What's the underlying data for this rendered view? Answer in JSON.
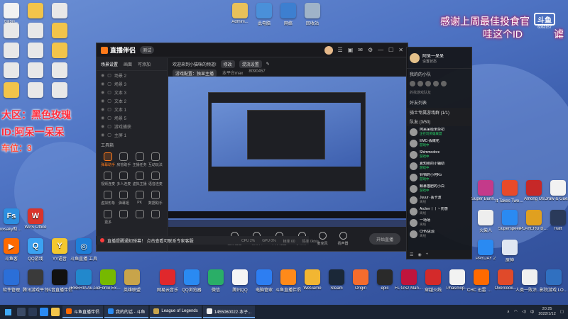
{
  "overlay": {
    "line1": "大区：黑色玫瑰",
    "line2": "ID:阿呆一呆呆",
    "line3": "车位：3",
    "top_right_line1": "感谢上周最佳投食官",
    "top_right_line2": "哇这个ID",
    "top_right_line3": "谑",
    "watermark_num": "6062157"
  },
  "desktop_top_icons": [
    {
      "label": "Admini...",
      "color": "#e8c15a"
    },
    {
      "label": "此电脑",
      "color": "#4a90d9"
    },
    {
      "label": "网络",
      "color": "#3d7fd0"
    },
    {
      "label": "回收站",
      "color": "#9fb3c8"
    }
  ],
  "desktop_left_icons": [
    {
      "label": "bilibili...",
      "color": "#f2f2f2"
    },
    {
      "label": "",
      "color": "#f2c44a"
    },
    {
      "label": "",
      "color": "#e8e8e8"
    },
    {
      "label": "",
      "color": "#e8e8e8"
    },
    {
      "label": "",
      "color": "#e8e8e8"
    },
    {
      "label": "",
      "color": "#f2c44a"
    },
    {
      "label": "",
      "color": "#e8e8e8"
    },
    {
      "label": "",
      "color": "#e8e8e8"
    },
    {
      "label": "",
      "color": "#f2c44a"
    },
    {
      "label": "",
      "color": "#e8e8e8"
    },
    {
      "label": "",
      "color": "#e8e8e8"
    },
    {
      "label": "",
      "color": "#e8e8e8"
    },
    {
      "label": "",
      "color": "#f2c44a"
    },
    {
      "label": "",
      "color": "#e8e8e8"
    },
    {
      "label": "",
      "color": "#e8e8e8"
    }
  ],
  "desktop_row1": [
    {
      "label": "Foxsaky助手 漫画",
      "color": "#2d8fe0",
      "glyph": "Fs"
    },
    {
      "label": "WPS Office",
      "color": "#d9342b",
      "glyph": "W"
    }
  ],
  "desktop_row2": [
    {
      "label": "斗鱼客",
      "color": "#ff6a00",
      "glyph": "▶"
    },
    {
      "label": "QQ游戏",
      "color": "#3ba2f2",
      "glyph": "Q"
    },
    {
      "label": "YY语音",
      "color": "#f4c82e",
      "glyph": "Y"
    },
    {
      "label": "斗鱼直播 工具",
      "color": "#1e7fd8",
      "glyph": "◎"
    }
  ],
  "desktop_bottom_row": [
    {
      "label": "软件管理",
      "color": "#2b6fd8"
    },
    {
      "label": "腾讯游戏平台",
      "color": "#3a3a3a"
    },
    {
      "label": "抖音直播伴侣",
      "color": "#111111"
    },
    {
      "label": "IRBERIA Audio...",
      "color": "#2288cc"
    },
    {
      "label": "GeForce Experience",
      "color": "#76b900"
    },
    {
      "label": "英雄联盟",
      "color": "#c8a44a"
    },
    {
      "label": "网易云音乐",
      "color": "#e0282c"
    },
    {
      "label": "QQ浏览器",
      "color": "#2a8af2"
    },
    {
      "label": "微信",
      "color": "#2aae67"
    },
    {
      "label": "腾讯QQ",
      "color": "#f5f5f5"
    },
    {
      "label": "电脑管家",
      "color": "#2d7ef2"
    },
    {
      "label": "斗鱼直播伴侣",
      "color": "#ff8a1a"
    },
    {
      "label": "WeGame",
      "color": "#f2b632"
    },
    {
      "label": "Steam",
      "color": "#1b2838"
    },
    {
      "label": "Origin",
      "color": "#f56c2d"
    },
    {
      "label": "epic",
      "color": "#2a2a2a"
    },
    {
      "label": "FL GS2 Mani...",
      "color": "#c0143c"
    },
    {
      "label": "穿越火线",
      "color": "#d42a2a"
    },
    {
      "label": "Phasmop...",
      "color": "#f2f2f2"
    },
    {
      "label": "CHC 迅雷 模拟器",
      "color": "#ff6a00"
    },
    {
      "label": "Overcook...",
      "color": "#e04a2a"
    },
    {
      "label": "人类一败涂地 Human Fa...",
      "color": "#f0f0f0"
    },
    {
      "label": "影院游戏 LOL 游乐",
      "color": "#3070c0"
    }
  ],
  "desktop_right_icons": [
    {
      "label": "Super Bunny Man",
      "color": "#c43a8a"
    },
    {
      "label": "It Takes Two 助手",
      "color": "#e84a2a"
    },
    {
      "label": "Among Us",
      "color": "#c62828"
    },
    {
      "label": "Draw & Guess",
      "color": "#f2f2f2"
    },
    {
      "label": "火柴人",
      "color": "#eeeeee"
    },
    {
      "label": "Superspeed",
      "color": "#2a8af2"
    },
    {
      "label": "PLAYERU BATTLEGR...",
      "color": "#e0a020"
    },
    {
      "label": "Raft",
      "color": "#2a3a5a"
    },
    {
      "label": "PAYDAY 2",
      "color": "#2a8af2"
    },
    {
      "label": "原神",
      "color": "#dfe6f2"
    }
  ],
  "app": {
    "logo": "直播伴侣",
    "version": "测试",
    "welcome": "欢迎来到小猫咪的频道!",
    "edit_btn": "修改",
    "setting_btn": "混流设置",
    "source_label": "游戏配置：独显主播",
    "fps": "本平台max",
    "id_label": "8090457",
    "side_tabs": [
      "场景设置",
      "画面",
      "可添加"
    ],
    "scenes": [
      "场景 2",
      "场景 3",
      "文本 3",
      "文本 2",
      "文本 1",
      "场景 5",
      "游戏捕获",
      "主屏 1"
    ],
    "tool_title": "工具箱",
    "tools": [
      "弹幕助手",
      "房管助手",
      "主播任务",
      "互动玩法",
      "视频连麦",
      "多人连麦",
      "虚拟主播",
      "语音连麦",
      "虚拟形象",
      "弹幕姬",
      "PK",
      "数据助手",
      "更多",
      "",
      "",
      ""
    ],
    "controls": [
      "直播画面",
      "摄像头",
      "文字贴图",
      "多媒体",
      "麦克风",
      "扬声器"
    ],
    "start_btn": "开始直播",
    "notice": "直播提醒通知弹幕！ 点击查看可联系专家客服",
    "stats": [
      "CPU 2%",
      "GPU 0%",
      "帧率 60",
      "码率 0kb/s"
    ],
    "end_stream": "结束直播"
  },
  "chat": {
    "name": "阿呆一呆呆",
    "sub": "设置状态",
    "section1": "我的的小队",
    "team_caption": "的找游戏队友",
    "group_tab": "好友列表",
    "group1": "骑士专属游戏群 (1/1)",
    "group2": "队友 (3/50)",
    "friends": [
      {
        "name": "阿呆呆给米杂初",
        "status": "正在玩英雄联盟"
      },
      {
        "name": "EMC-丢嫩花",
        "status": "游戏中"
      },
      {
        "name": "Shimmodore",
        "status": "游戏中"
      },
      {
        "name": "夏知那的小辅助",
        "status": "游戏中"
      },
      {
        "name": "铃铛的小何Ko",
        "status": "游戏中"
      },
      {
        "name": "鲸慕猫肥的小白",
        "status": "游戏中"
      },
      {
        "name": "Juuur ·丢卡波",
        "status": "离线"
      },
      {
        "name": "Archer丨丨丶伤感",
        "status": "离线"
      },
      {
        "name": "一场场",
        "status": "离线"
      },
      {
        "name": "CHN思源",
        "status": "离线"
      }
    ]
  },
  "taskbar": {
    "tasks": [
      {
        "label": "斗鱼直播伴侣",
        "color": "#ff6a00"
      },
      {
        "label": "我的的话 - 斗鱼",
        "color": "#2a8af2"
      },
      {
        "label": "League of Legends",
        "color": "#c8a44a"
      },
      {
        "label": "1455060022·本子...",
        "color": "#f2f2f2"
      }
    ],
    "time": "20:25",
    "date": "2022/1/12",
    "lang": "中"
  }
}
